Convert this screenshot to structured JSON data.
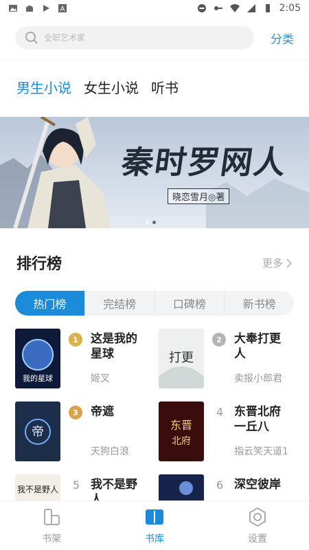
{
  "status_bar": {
    "time": "2:05"
  },
  "search": {
    "placeholder": "全职艺术家"
  },
  "header": {
    "classify_label": "分类"
  },
  "categories": [
    {
      "label": "男生小说",
      "active": true
    },
    {
      "label": "女生小说",
      "active": false
    },
    {
      "label": "听书",
      "active": false
    }
  ],
  "banner": {
    "title": "秦时罗网人",
    "author": "晓恋雪月◎著",
    "slide_count": 2,
    "active_slide": 1
  },
  "ranking": {
    "title": "排行榜",
    "more_label": "更多",
    "tabs": [
      {
        "label": "热门榜",
        "active": true
      },
      {
        "label": "完结榜",
        "active": false
      },
      {
        "label": "口碑榜",
        "active": false
      },
      {
        "label": "新书榜",
        "active": false
      }
    ],
    "books": [
      {
        "rank": "1",
        "name": "这是我的星球",
        "author": "姬叉"
      },
      {
        "rank": "2",
        "name": "大奉打更人",
        "author": "卖报小郎君"
      },
      {
        "rank": "3",
        "name": "帝遮",
        "author": "天狗白浪"
      },
      {
        "rank": "4",
        "name": "东晋北府一丘八",
        "author": "指云笑天道1"
      },
      {
        "rank": "5",
        "name": "我不是野人",
        "author": ""
      },
      {
        "rank": "6",
        "name": "深空彼岸",
        "author": ""
      }
    ]
  },
  "bottom_nav": [
    {
      "label": "书架",
      "icon": "bookshelf-icon",
      "active": false
    },
    {
      "label": "书库",
      "icon": "library-icon",
      "active": true
    },
    {
      "label": "设置",
      "icon": "settings-icon",
      "active": false
    }
  ],
  "colors": {
    "accent": "#1a8ad9",
    "accent_text": "#2d8fd5",
    "gold": "#d9b24c",
    "silver": "#b5b5b5",
    "bronze": "#d9a24c"
  }
}
